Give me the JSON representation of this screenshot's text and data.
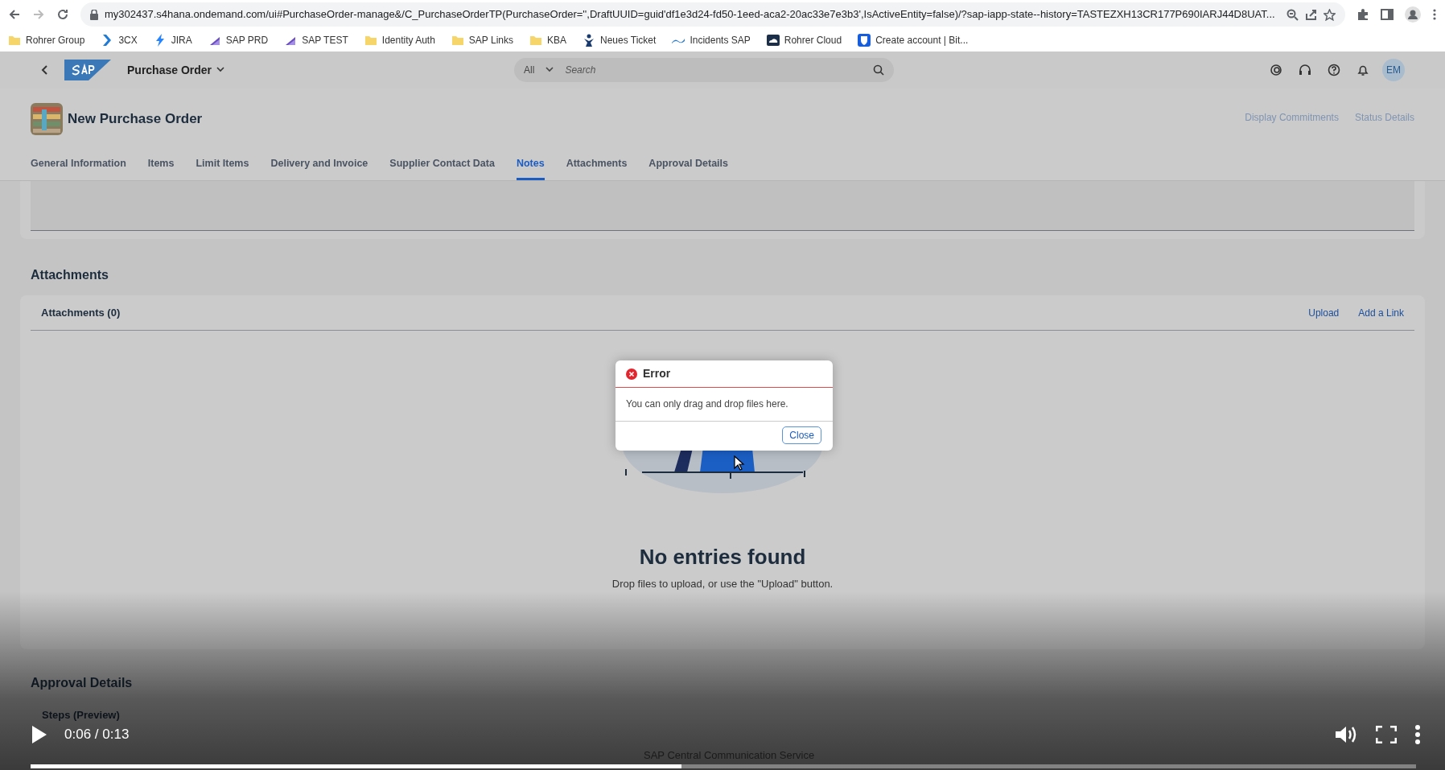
{
  "browser": {
    "address": "my302437.s4hana.ondemand.com/ui#PurchaseOrder-manage&/C_PurchaseOrderTP(PurchaseOrder='',DraftUUID=guid'df1e3d24-fd50-1eed-aca2-20ac33e7e3b3',IsActiveEntity=false)/?sap-iapp-state--history=TASTEZXH13CR177P690IARJ44D8UAT...",
    "bookmarks": [
      {
        "kind": "folder",
        "label": "Rohrer Group"
      },
      {
        "kind": "chevron",
        "label": "3CX"
      },
      {
        "kind": "bolt",
        "label": "JIRA"
      },
      {
        "kind": "stack",
        "label": "SAP PRD"
      },
      {
        "kind": "stack",
        "label": "SAP TEST"
      },
      {
        "kind": "folder",
        "label": "Identity Auth"
      },
      {
        "kind": "folder",
        "label": "SAP Links"
      },
      {
        "kind": "folder",
        "label": "KBA"
      },
      {
        "kind": "figure",
        "label": "Neues Ticket"
      },
      {
        "kind": "wave",
        "label": "Incidents SAP"
      },
      {
        "kind": "cloud",
        "label": "Rohrer Cloud"
      },
      {
        "kind": "shield",
        "label": "Create account | Bit..."
      }
    ]
  },
  "shell": {
    "app_title": "Purchase Order",
    "search_scope": "All",
    "search_placeholder": "Search",
    "avatar": "EM"
  },
  "header": {
    "title": "New Purchase Order",
    "actions": [
      "Display Commitments",
      "Status Details"
    ]
  },
  "tabs": [
    {
      "label": "General Information",
      "selected": false
    },
    {
      "label": "Items",
      "selected": false
    },
    {
      "label": "Limit Items",
      "selected": false
    },
    {
      "label": "Delivery and Invoice",
      "selected": false
    },
    {
      "label": "Supplier Contact Data",
      "selected": false
    },
    {
      "label": "Notes",
      "selected": true
    },
    {
      "label": "Attachments",
      "selected": false
    },
    {
      "label": "Approval Details",
      "selected": false
    }
  ],
  "attachments": {
    "heading": "Attachments",
    "toolbar_title": "Attachments (0)",
    "actions": [
      "Upload",
      "Add a Link"
    ],
    "empty_title": "No entries found",
    "empty_text": "Drop files to upload, or use the \"Upload\" button."
  },
  "approval": {
    "heading": "Approval Details",
    "subheading": "Steps (Preview)",
    "cell": "SAP Central Communication Service"
  },
  "dialog": {
    "title": "Error",
    "message": "You can only drag and drop files here.",
    "button": "Close"
  },
  "player": {
    "time": "0:06 / 0:13",
    "level": 0.47
  }
}
